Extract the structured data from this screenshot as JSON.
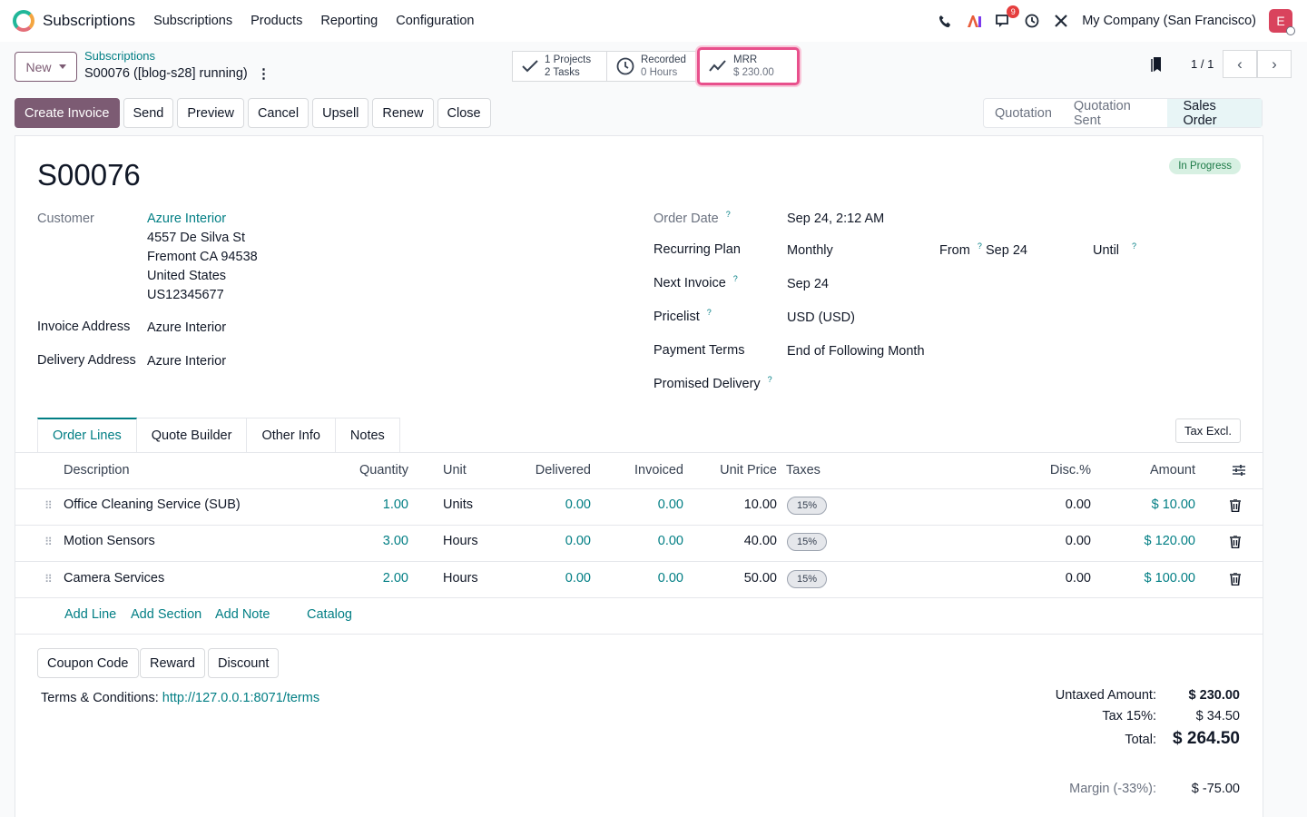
{
  "nav": {
    "app_name": "Subscriptions",
    "menu": [
      "Subscriptions",
      "Products",
      "Reporting",
      "Configuration"
    ],
    "chat_badge": "9",
    "company": "My Company (San Francisco)",
    "avatar_letter": "E"
  },
  "control": {
    "new_label": "New",
    "breadcrumb_parent": "Subscriptions",
    "breadcrumb_current": "S00076 ([blog-s28] running)",
    "smart_projects_1": "1  Projects",
    "smart_projects_2": "2  Tasks",
    "smart_recorded_1": "Recorded",
    "smart_recorded_2": "0  Hours",
    "smart_mrr_1": "MRR",
    "smart_mrr_2": "$ 230.00",
    "pager": "1 / 1"
  },
  "actions": {
    "buttons": [
      "Create Invoice",
      "Send",
      "Preview",
      "Cancel",
      "Upsell",
      "Renew",
      "Close"
    ],
    "stages": [
      "Quotation",
      "Quotation Sent",
      "Sales Order"
    ]
  },
  "form": {
    "title": "S00076",
    "ribbon": "In Progress",
    "customer_label": "Customer",
    "customer_name": "Azure Interior",
    "customer_addr": [
      "4557 De Silva St",
      "Fremont CA 94538",
      "United States",
      "US12345677"
    ],
    "invoice_address_label": "Invoice Address",
    "invoice_address": "Azure Interior",
    "delivery_address_label": "Delivery Address",
    "delivery_address": "Azure Interior",
    "order_date_label": "Order Date",
    "order_date": "Sep 24, 2:12 AM",
    "recurring_plan_label": "Recurring Plan",
    "recurring_plan": "Monthly",
    "from_label": "From",
    "from_value": "Sep 24",
    "until_label": "Until",
    "next_invoice_label": "Next Invoice",
    "next_invoice": "Sep 24",
    "pricelist_label": "Pricelist",
    "pricelist": "USD (USD)",
    "payment_terms_label": "Payment Terms",
    "payment_terms": "End of Following Month",
    "promised_delivery_label": "Promised Delivery",
    "help_mark": "?"
  },
  "tabs": [
    "Order Lines",
    "Quote Builder",
    "Other Info",
    "Notes"
  ],
  "tax_button": "Tax Excl.",
  "table": {
    "headers": {
      "description": "Description",
      "quantity": "Quantity",
      "unit": "Unit",
      "delivered": "Delivered",
      "invoiced": "Invoiced",
      "unit_price": "Unit Price",
      "taxes": "Taxes",
      "disc": "Disc.%",
      "amount": "Amount"
    },
    "rows": [
      {
        "description": "Office Cleaning Service (SUB)",
        "quantity": "1.00",
        "unit": "Units",
        "delivered": "0.00",
        "invoiced": "0.00",
        "unit_price": "10.00",
        "tax": "15%",
        "disc": "0.00",
        "amount": "$ 10.00"
      },
      {
        "description": "Motion Sensors",
        "quantity": "3.00",
        "unit": "Hours",
        "delivered": "0.00",
        "invoiced": "0.00",
        "unit_price": "40.00",
        "tax": "15%",
        "disc": "0.00",
        "amount": "$ 120.00"
      },
      {
        "description": "Camera Services",
        "quantity": "2.00",
        "unit": "Hours",
        "delivered": "0.00",
        "invoiced": "0.00",
        "unit_price": "50.00",
        "tax": "15%",
        "disc": "0.00",
        "amount": "$ 100.00"
      }
    ],
    "add_links": [
      "Add Line",
      "Add Section",
      "Add Note",
      "Catalog"
    ]
  },
  "promo_buttons": [
    "Coupon Code",
    "Reward",
    "Discount"
  ],
  "terms": {
    "label": "Terms & Conditions:",
    "link": "http://127.0.0.1:8071/terms"
  },
  "totals": {
    "untaxed_label": "Untaxed Amount:",
    "untaxed": "$ 230.00",
    "tax_label": "Tax 15%:",
    "tax": "$ 34.50",
    "total_label": "Total:",
    "total": "$ 264.50",
    "margin_label": "Margin (-33%):",
    "margin": "$ -75.00"
  },
  "colors": {
    "primary": "#7c5b73",
    "link": "#017e84",
    "highlight": "#e8508c"
  }
}
